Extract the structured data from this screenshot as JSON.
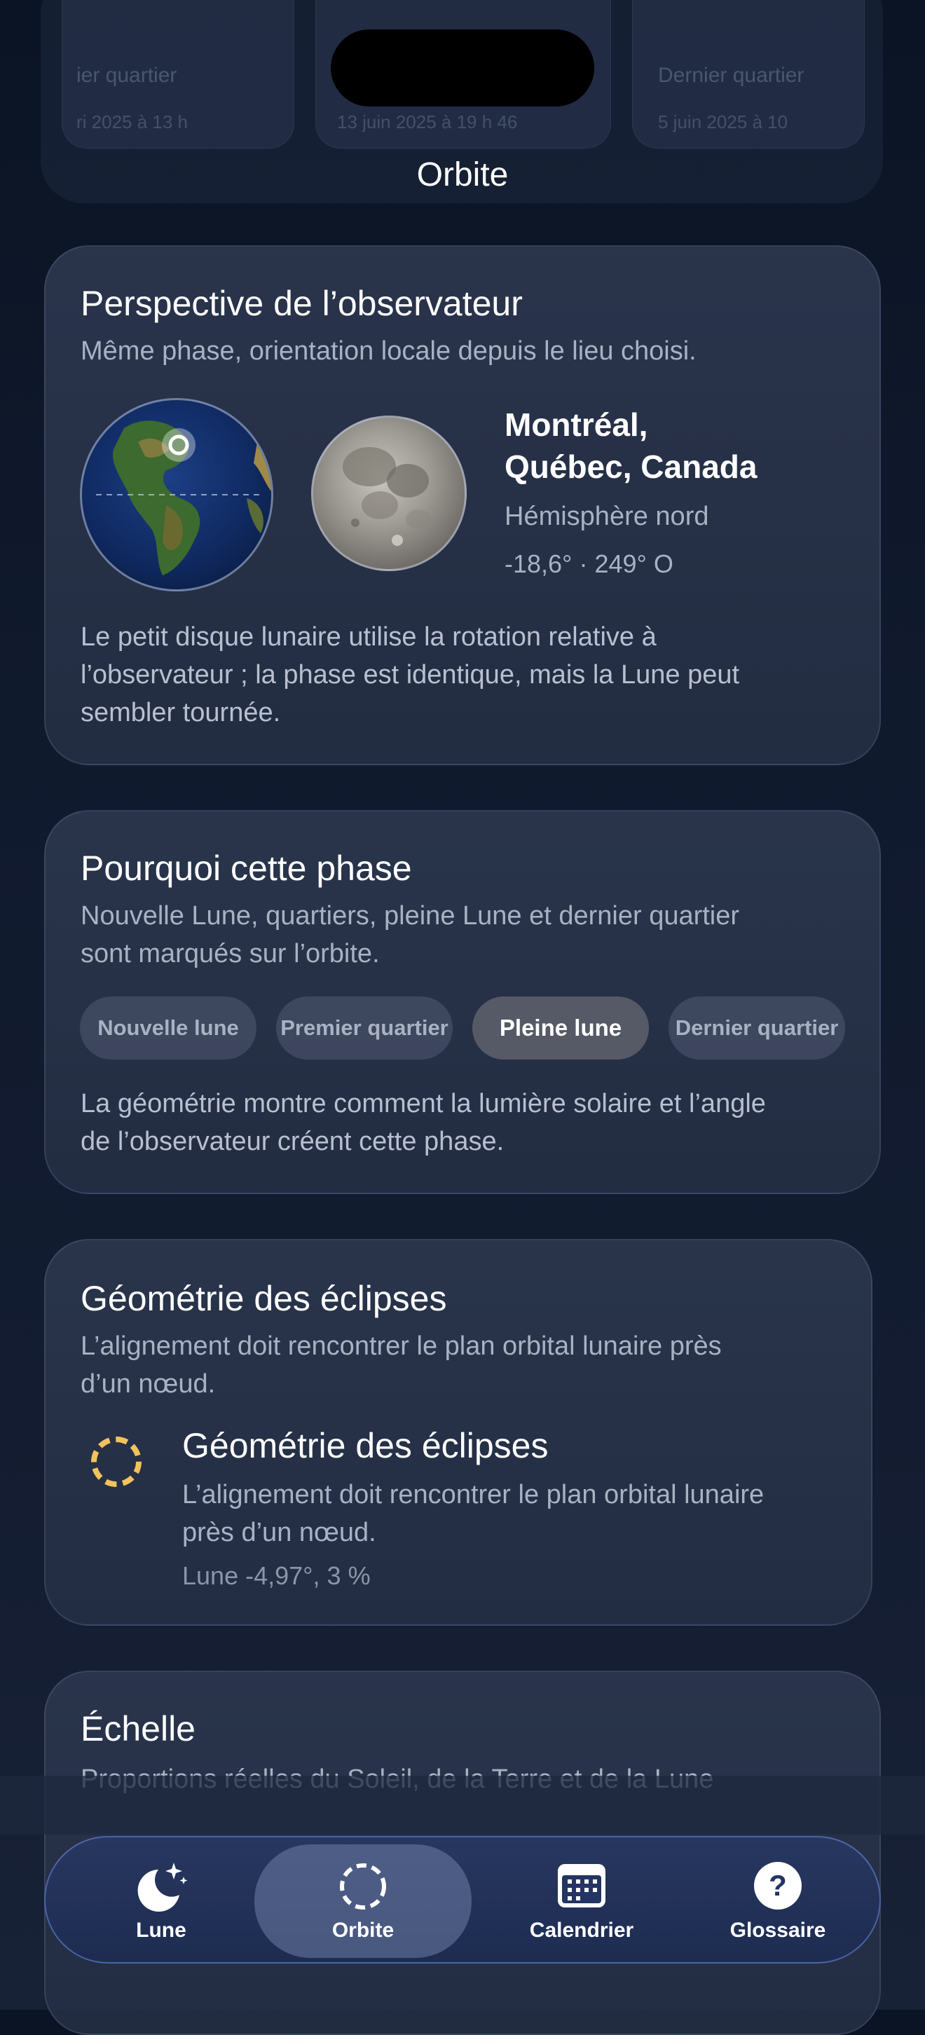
{
  "header": {
    "title": "Orbite"
  },
  "top_cards": [
    {
      "title": "ier quartier",
      "date": "ri 2025 à 13 h"
    },
    {
      "title": "",
      "date": "13 juin 2025 à 19 h 46"
    },
    {
      "title": "Dernier quartier",
      "date": "5 juin 2025 à 10"
    }
  ],
  "observer": {
    "title": "Perspective de l’observateur",
    "subtitle": "Même phase, orientation locale depuis le lieu choisi.",
    "city_line1": "Montréal,",
    "city_line2": "Québec, Canada",
    "hemisphere": "Hémisphère nord",
    "coords": "-18,6° · 249° O",
    "note_line1": "Le petit disque lunaire utilise la rotation relative à",
    "note_line2": "l’observateur ; la phase est identique, mais la Lune peut",
    "note_line3": "sembler tournée."
  },
  "phase": {
    "title": "Pourquoi cette phase",
    "subtitle_line1": "Nouvelle Lune, quartiers, pleine Lune et dernier quartier",
    "subtitle_line2": "sont marqués sur l’orbite.",
    "chips": [
      "Nouvelle lune",
      "Premier quartier",
      "Pleine lune",
      "Dernier quartier"
    ],
    "selected": "Pleine lune",
    "note_line1": "La géométrie montre comment la lumière solaire et l’angle",
    "note_line2": "de l’observateur créent cette phase."
  },
  "eclipse": {
    "title": "Géométrie des éclipses",
    "subtitle_line1": "L’alignement doit rencontrer le plan orbital lunaire près",
    "subtitle_line2": "d’un nœud.",
    "item_title": "Géométrie des éclipses",
    "item_desc_line1": "L’alignement doit rencontrer le plan orbital lunaire",
    "item_desc_line2": "près d’un nœud.",
    "item_value": "Lune -4,97°, 3 %",
    "ring_color": "#f1c35d"
  },
  "scale": {
    "title": "Échelle",
    "subtitle": "Proportions réelles du Soleil, de la Terre et de la Lune"
  },
  "tabbar": {
    "tabs": [
      {
        "label": "Lune",
        "icon": "moon-stars-icon"
      },
      {
        "label": "Orbite",
        "icon": "dashed-circle-icon"
      },
      {
        "label": "Calendrier",
        "icon": "calendar-icon"
      },
      {
        "label": "Glossaire",
        "icon": "question-circle-icon"
      }
    ],
    "selected": "Orbite"
  }
}
